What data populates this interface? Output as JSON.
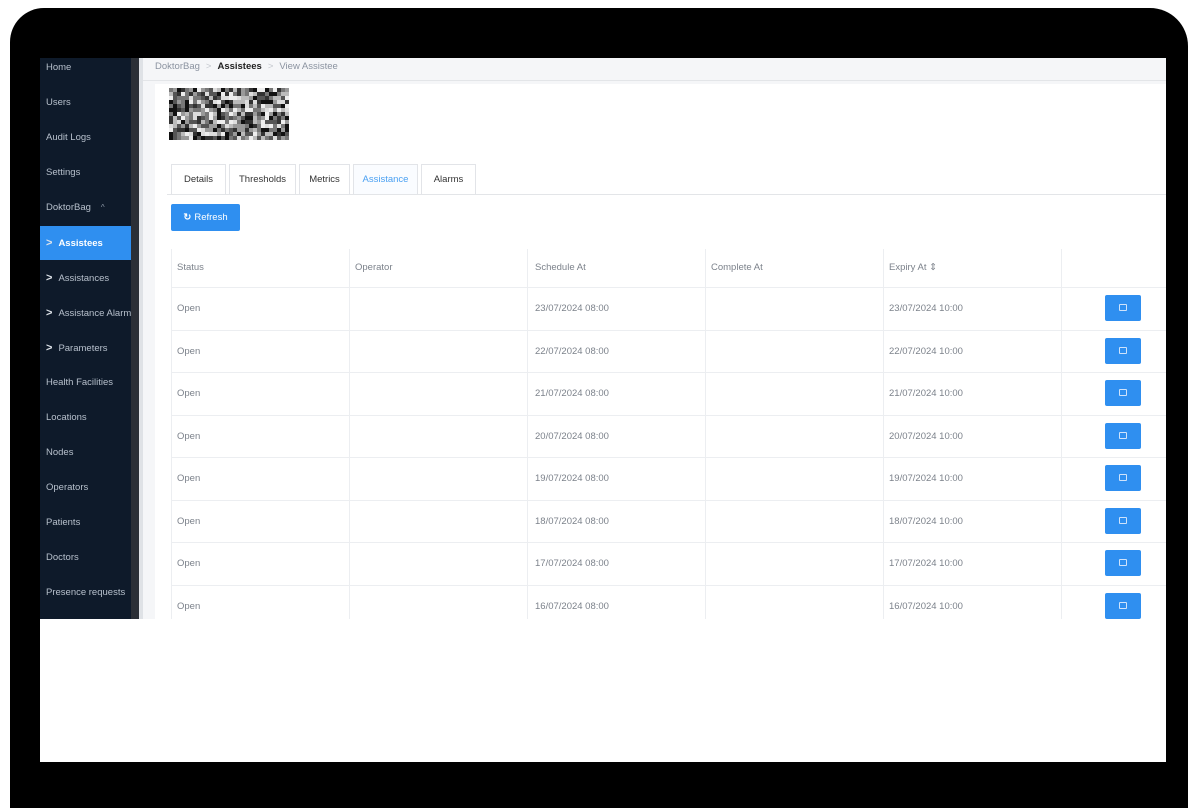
{
  "sidebar": {
    "items": [
      {
        "label": "Home",
        "chevron": false,
        "active": false
      },
      {
        "label": "Users",
        "chevron": false,
        "active": false
      },
      {
        "label": "Audit Logs",
        "chevron": false,
        "active": false
      },
      {
        "label": "Settings",
        "chevron": false,
        "active": false
      },
      {
        "label": "DoktorBag",
        "chevron": false,
        "active": false,
        "expand": "^"
      },
      {
        "label": "Assistees",
        "chevron": true,
        "active": true
      },
      {
        "label": "Assistances",
        "chevron": true,
        "active": false
      },
      {
        "label": "Assistance Alarms",
        "chevron": true,
        "active": false
      },
      {
        "label": "Parameters",
        "chevron": true,
        "active": false
      },
      {
        "label": "Health Facilities",
        "chevron": false,
        "active": false
      },
      {
        "label": "Locations",
        "chevron": false,
        "active": false
      },
      {
        "label": "Nodes",
        "chevron": false,
        "active": false
      },
      {
        "label": "Operators",
        "chevron": false,
        "active": false
      },
      {
        "label": "Patients",
        "chevron": false,
        "active": false
      },
      {
        "label": "Doctors",
        "chevron": false,
        "active": false
      },
      {
        "label": "Presence requests",
        "chevron": false,
        "active": false
      }
    ]
  },
  "breadcrumb": {
    "root": "DoktorBag",
    "section": "Assistees",
    "page": "View Assistee",
    "separator": ">"
  },
  "tabs": [
    "Details",
    "Thresholds",
    "Metrics",
    "Assistance",
    "Alarms"
  ],
  "active_tab": "Assistance",
  "refresh_button": {
    "icon": "refresh-icon",
    "label": "Refresh"
  },
  "table": {
    "headers": [
      "Status",
      "Operator",
      "Schedule At",
      "Complete At",
      "Expiry At ⇕",
      ""
    ],
    "rows": [
      {
        "status": "Open",
        "operator": "",
        "schedule_at": "23/07/2024 08:00",
        "complete_at": "",
        "expiry_at": "23/07/2024 10:00"
      },
      {
        "status": "Open",
        "operator": "",
        "schedule_at": "22/07/2024 08:00",
        "complete_at": "",
        "expiry_at": "22/07/2024 10:00"
      },
      {
        "status": "Open",
        "operator": "",
        "schedule_at": "21/07/2024 08:00",
        "complete_at": "",
        "expiry_at": "21/07/2024 10:00"
      },
      {
        "status": "Open",
        "operator": "",
        "schedule_at": "20/07/2024 08:00",
        "complete_at": "",
        "expiry_at": "20/07/2024 10:00"
      },
      {
        "status": "Open",
        "operator": "",
        "schedule_at": "19/07/2024 08:00",
        "complete_at": "",
        "expiry_at": "19/07/2024 10:00"
      },
      {
        "status": "Open",
        "operator": "",
        "schedule_at": "18/07/2024 08:00",
        "complete_at": "",
        "expiry_at": "18/07/2024 10:00"
      },
      {
        "status": "Open",
        "operator": "",
        "schedule_at": "17/07/2024 08:00",
        "complete_at": "",
        "expiry_at": "17/07/2024 10:00"
      },
      {
        "status": "Open",
        "operator": "",
        "schedule_at": "16/07/2024 08:00",
        "complete_at": "",
        "expiry_at": "16/07/2024 10:00"
      }
    ],
    "action_icon": "calendar-icon"
  },
  "colors": {
    "accent": "#2f8ff0",
    "sidebar_bg": "#0e1a2a",
    "active_tab_text": "#4aa0f2"
  }
}
